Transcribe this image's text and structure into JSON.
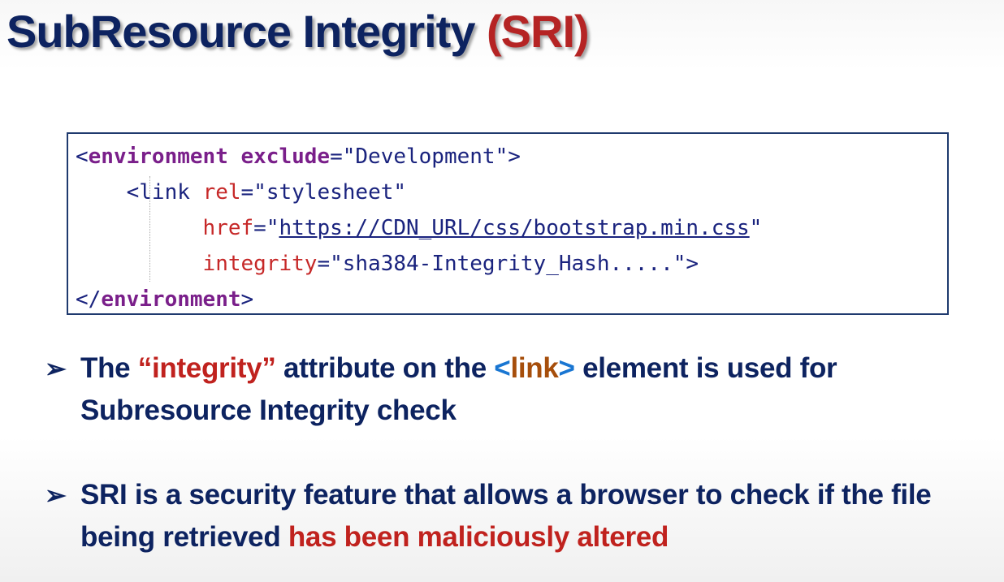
{
  "title": {
    "main": "SubResource Integrity ",
    "accent": "(SRI)"
  },
  "code": {
    "line1": {
      "open": "<",
      "tag": "environment",
      "attr": "exclude",
      "eq": "=",
      "value": "\"Development\"",
      "close": ">"
    },
    "line2": {
      "indent": "    ",
      "open": "<",
      "tag": "link",
      "attr": "rel",
      "eq": "=",
      "value": "\"stylesheet\""
    },
    "line3": {
      "indent": "          ",
      "attr": "href",
      "eq": "=",
      "quote_open": "\"",
      "url": "https://CDN_URL/css/bootstrap.min.css",
      "quote_close": "\""
    },
    "line4": {
      "indent": "          ",
      "attr": "integrity",
      "eq": "=",
      "value": "\"sha384-Integrity_Hash.....\"",
      "close": ">"
    },
    "line5": {
      "open": "</",
      "tag": "environment",
      "close": ">"
    }
  },
  "bullets": [
    {
      "arrow": "➢",
      "part1": "The ",
      "highlight1": "“integrity”",
      "part2": " attribute on the ",
      "tag_open": "<",
      "tag_name": "link",
      "tag_close": ">",
      "part3": " element is used for Subresource Integrity check"
    },
    {
      "arrow": "➢",
      "part1": "SRI is a security feature that allows a browser to check if the file being retrieved ",
      "highlight1": "has been maliciously altered"
    }
  ],
  "colors": {
    "title": "#0d2360",
    "accent": "#b52424",
    "code_tag": "#7a1f8a",
    "code_attr": "#c62828",
    "code_value": "#1a237e",
    "link_bracket": "#1976d2",
    "link_name": "#a64e0b"
  }
}
